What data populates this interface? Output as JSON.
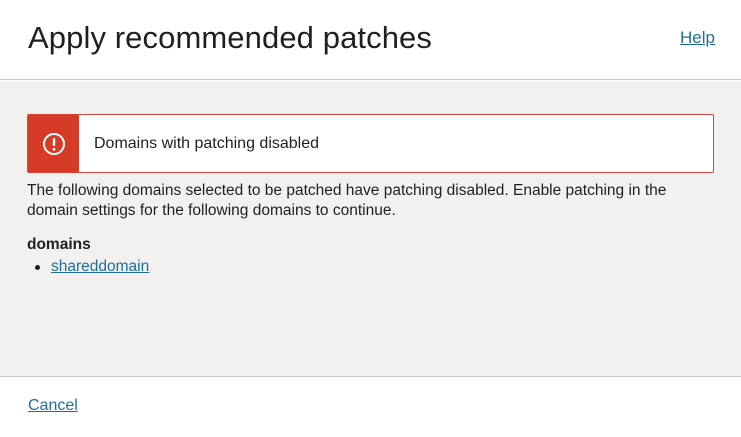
{
  "dialog": {
    "title": "Apply recommended patches",
    "help_label": "Help"
  },
  "banner": {
    "icon": "error-exclamation-icon",
    "title": "Domains with patching disabled",
    "accent_color": "#d63b28"
  },
  "message": "The following domains selected to be patched have patching disabled. Enable patching in the domain settings for the following domains to continue.",
  "domains": {
    "heading": "domains",
    "items": [
      "shareddomain"
    ]
  },
  "footer": {
    "cancel_label": "Cancel"
  },
  "colors": {
    "link": "#1e6e9c",
    "body_background": "#f2f1f0",
    "error": "#d63b28"
  }
}
